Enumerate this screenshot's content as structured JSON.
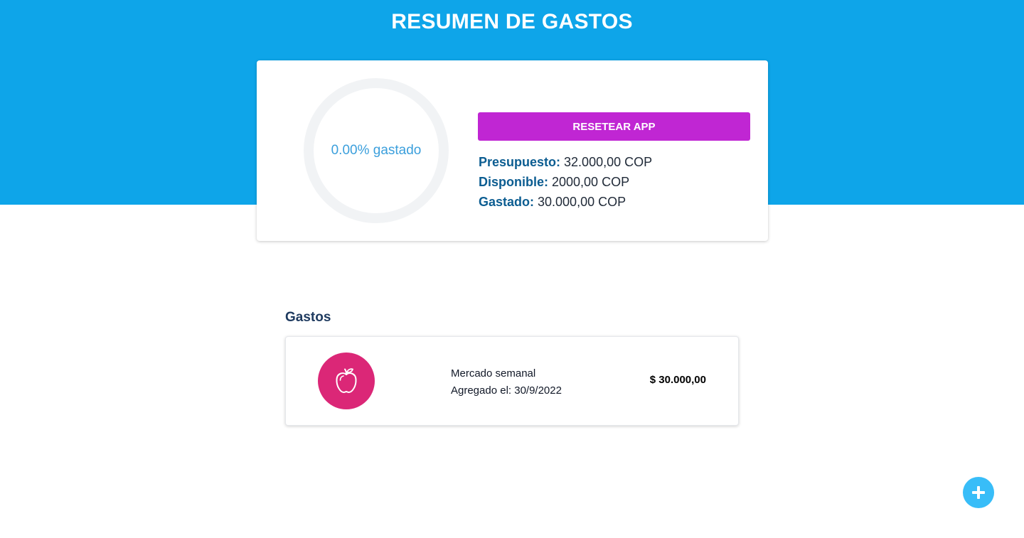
{
  "header": {
    "title": "RESUMEN DE GASTOS",
    "background_color": "#0ea5e9"
  },
  "summary": {
    "progress_percent": 0,
    "progress_text": "0.00% gastado",
    "reset_button_label": "RESETEAR APP",
    "reset_button_color": "#c026d3",
    "budget": {
      "label": "Presupuesto:",
      "value": "32.000,00 COP"
    },
    "available": {
      "label": "Disponible:",
      "value": "2000,00 COP"
    },
    "spent": {
      "label": "Gastado:",
      "value": "30.000,00 COP"
    }
  },
  "expenses": {
    "section_title": "Gastos",
    "items": [
      {
        "name": "Mercado semanal",
        "date": "Agregado el: 30/9/2022",
        "amount": "$ 30.000,00",
        "icon": "apple-icon",
        "icon_color": "#db2777"
      }
    ]
  },
  "fab": {
    "icon": "plus-icon",
    "color": "#38bdf8"
  }
}
